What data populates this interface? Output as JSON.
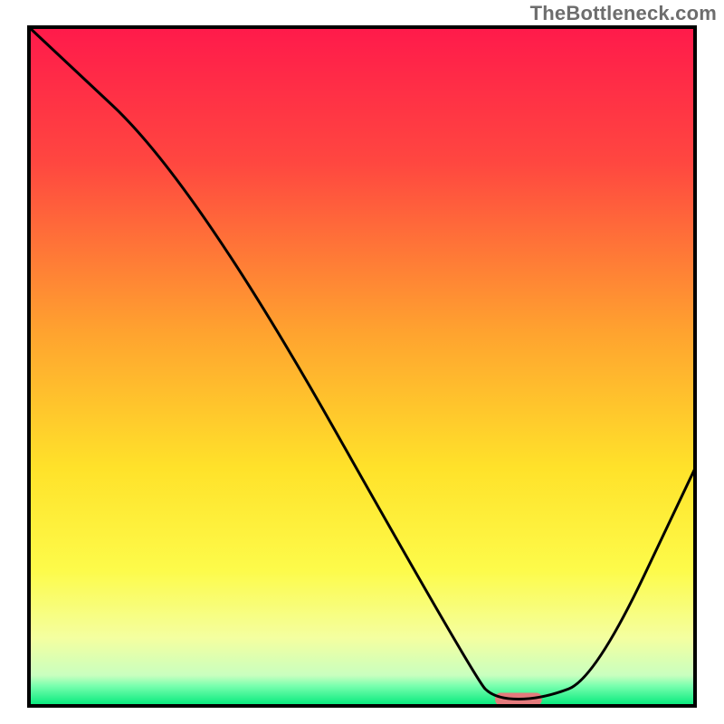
{
  "watermark": "TheBottleneck.com",
  "chart_data": {
    "type": "line",
    "title": "",
    "xlabel": "",
    "ylabel": "",
    "xlim": [
      0,
      100
    ],
    "ylim": [
      0,
      100
    ],
    "x": [
      0,
      25,
      67,
      70,
      77,
      85,
      100
    ],
    "values": [
      100,
      77,
      4,
      1,
      1,
      4,
      35
    ],
    "marker": {
      "x_start": 70,
      "x_end": 77,
      "y": 1
    },
    "background_gradient": [
      {
        "stop": 0.0,
        "color": "#ff1a4b"
      },
      {
        "stop": 0.2,
        "color": "#ff4740"
      },
      {
        "stop": 0.45,
        "color": "#ffa32f"
      },
      {
        "stop": 0.65,
        "color": "#ffe22a"
      },
      {
        "stop": 0.8,
        "color": "#fdfb4a"
      },
      {
        "stop": 0.9,
        "color": "#f4ffa0"
      },
      {
        "stop": 0.955,
        "color": "#c9ffbf"
      },
      {
        "stop": 0.97,
        "color": "#7bffaf"
      },
      {
        "stop": 1.0,
        "color": "#00e97a"
      }
    ],
    "curve_color": "#000000",
    "marker_color": "#e47a7c",
    "frame_color": "#000000"
  }
}
